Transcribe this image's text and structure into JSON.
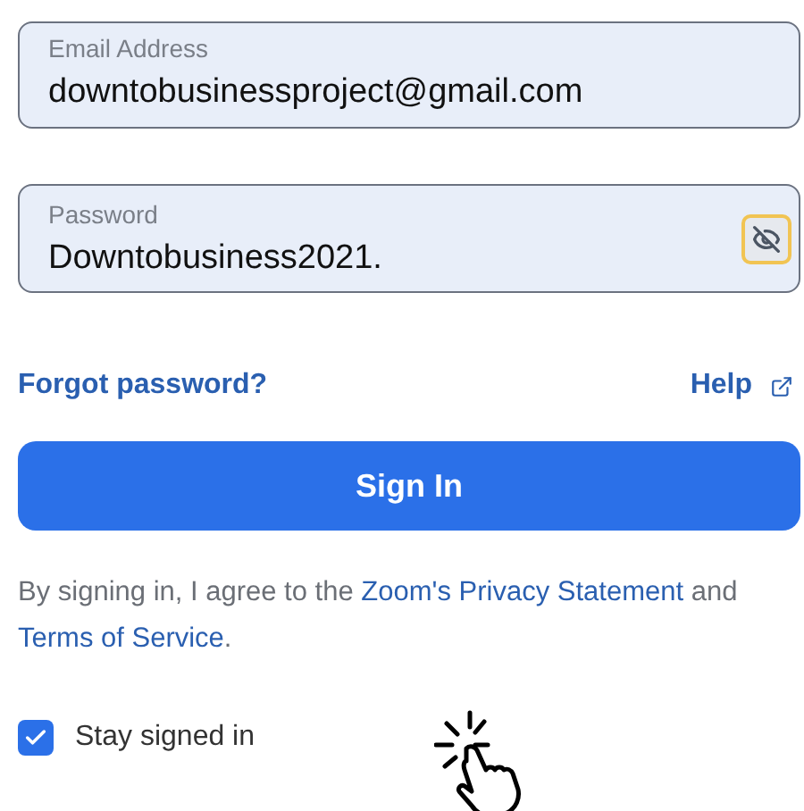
{
  "email_field": {
    "label": "Email Address",
    "value": "downtobusinessproject@gmail.com"
  },
  "password_field": {
    "label": "Password",
    "value": "Downtobusiness2021.",
    "revealed": true
  },
  "links": {
    "forgot": "Forgot password?",
    "help": "Help"
  },
  "sign_in_button": "Sign In",
  "agreement": {
    "before": "By signing in, I agree to the ",
    "privacy_link": "Zoom's Privacy Statement",
    "middle": " and ",
    "terms_link": "Terms of Service",
    "after": "."
  },
  "stay_signed_in": {
    "label": "Stay signed in",
    "checked": true
  }
}
